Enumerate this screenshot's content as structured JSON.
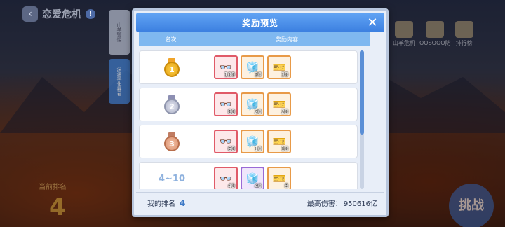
{
  "game": {
    "title": "恋爱危机",
    "side_tabs": [
      "山羊警惕",
      "深渊黑化暴君"
    ],
    "right_icons": [
      "山羊危机",
      "OOSOOO防",
      "排行榜"
    ],
    "current_rank_label": "当前排名",
    "current_rank_value": "4",
    "challenge_label": "挑战"
  },
  "modal": {
    "title": "奖励预览",
    "columns": {
      "rank": "名次",
      "rewards": "奖励内容"
    },
    "rows": [
      {
        "rank_type": "medal",
        "rank_label": "1",
        "medal": "gold",
        "items": [
          {
            "icon": "goggles-icon",
            "glyph": "👓",
            "frame": "red",
            "qty": "100"
          },
          {
            "icon": "crystal-icon",
            "glyph": "🧊",
            "frame": "orange",
            "qty": "30"
          },
          {
            "icon": "ticket-icon",
            "glyph": "🎫",
            "frame": "orange",
            "qty": "30"
          }
        ]
      },
      {
        "rank_type": "medal",
        "rank_label": "2",
        "medal": "silver",
        "items": [
          {
            "icon": "goggles-icon",
            "glyph": "👓",
            "frame": "red",
            "qty": "80"
          },
          {
            "icon": "crystal-icon",
            "glyph": "🧊",
            "frame": "orange",
            "qty": "20"
          },
          {
            "icon": "ticket-icon",
            "glyph": "🎫",
            "frame": "orange",
            "qty": "20"
          }
        ]
      },
      {
        "rank_type": "medal",
        "rank_label": "3",
        "medal": "bronze",
        "items": [
          {
            "icon": "goggles-icon",
            "glyph": "👓",
            "frame": "red",
            "qty": "60"
          },
          {
            "icon": "crystal-icon",
            "glyph": "🧊",
            "frame": "orange",
            "qty": "10"
          },
          {
            "icon": "ticket-icon",
            "glyph": "🎫",
            "frame": "orange",
            "qty": "10"
          }
        ]
      },
      {
        "rank_type": "text",
        "rank_label": "4~10",
        "medal": "",
        "items": [
          {
            "icon": "goggles-icon",
            "glyph": "👓",
            "frame": "red",
            "qty": "40"
          },
          {
            "icon": "crystal-icon",
            "glyph": "🧊",
            "frame": "purple",
            "qty": "40"
          },
          {
            "icon": "ticket-icon",
            "glyph": "🎫",
            "frame": "orange",
            "qty": "8"
          }
        ]
      }
    ],
    "footer": {
      "my_rank_label": "我的排名",
      "my_rank_value": "4",
      "damage_label": "最高伤害：",
      "damage_value": "950616亿"
    }
  },
  "colors": {
    "accent": "#3b7fe0",
    "header_bar": "#7fb8f0"
  }
}
